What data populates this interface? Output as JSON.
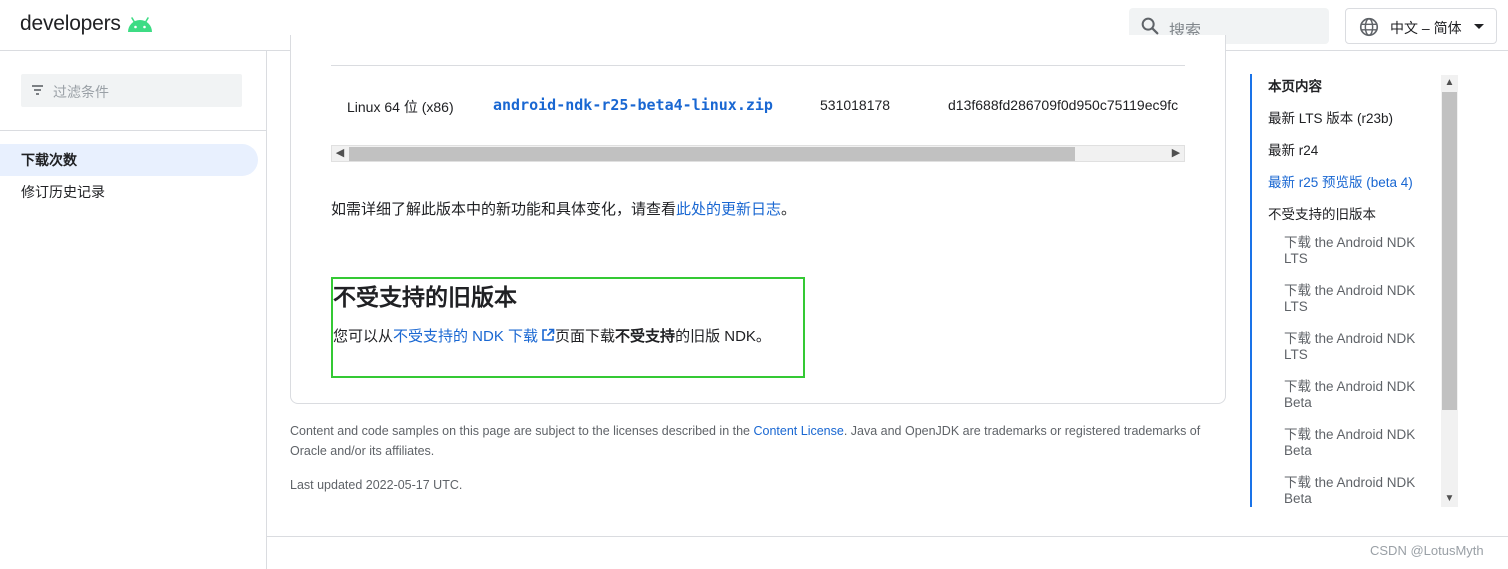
{
  "header": {
    "logo_text": "developers",
    "search_placeholder": "搜索",
    "language": "中文 – 简体"
  },
  "leftnav": {
    "filter_placeholder": "过滤条件",
    "items": [
      {
        "label": "下载次数"
      },
      {
        "label": "修订历史记录"
      }
    ]
  },
  "table": {
    "os": "Linux 64 位 (x86)",
    "file": "android-ndk-r25-beta4-linux.zip",
    "size": "531018178",
    "hash": "d13f688fd286709f0d950c75119ec9fc"
  },
  "main": {
    "para_prefix": "如需详细了解此版本中的新功能和具体变化，请查看",
    "para_link": "此处的更新日志",
    "para_suffix": "。",
    "section_title": "不受支持的旧版本",
    "section_prefix": "您可以从",
    "section_link": "不受支持的 NDK 下载",
    "section_mid": "页面下载",
    "section_bold": "不受支持",
    "section_suffix": "的旧版 NDK。"
  },
  "footer": {
    "license_prefix": "Content and code samples on this page are subject to the licenses described in the ",
    "license_link": "Content License",
    "license_suffix": ". Java and OpenJDK are trademarks or registered trademarks of Oracle and/or its affiliates.",
    "updated": "Last updated 2022-05-17 UTC.",
    "watermark": "CSDN @LotusMyth"
  },
  "toc": {
    "title": "本页内容",
    "items": [
      {
        "label": "最新 LTS 版本 (r23b)"
      },
      {
        "label": "最新 r24"
      },
      {
        "label": "最新 r25 预览版 (beta 4)"
      },
      {
        "label": "不受支持的旧版本"
      }
    ],
    "subitems": [
      {
        "label": "下载 the Android NDK LTS"
      },
      {
        "label": "下载 the Android NDK LTS"
      },
      {
        "label": "下载 the Android NDK LTS"
      },
      {
        "label": "下载 the Android NDK Beta"
      },
      {
        "label": "下载 the Android NDK Beta"
      },
      {
        "label": "下载 the Android NDK Beta"
      }
    ]
  },
  "colors": {
    "link": "#1967d2",
    "android_green": "#3ddc84",
    "highlight_border": "#34c934"
  }
}
